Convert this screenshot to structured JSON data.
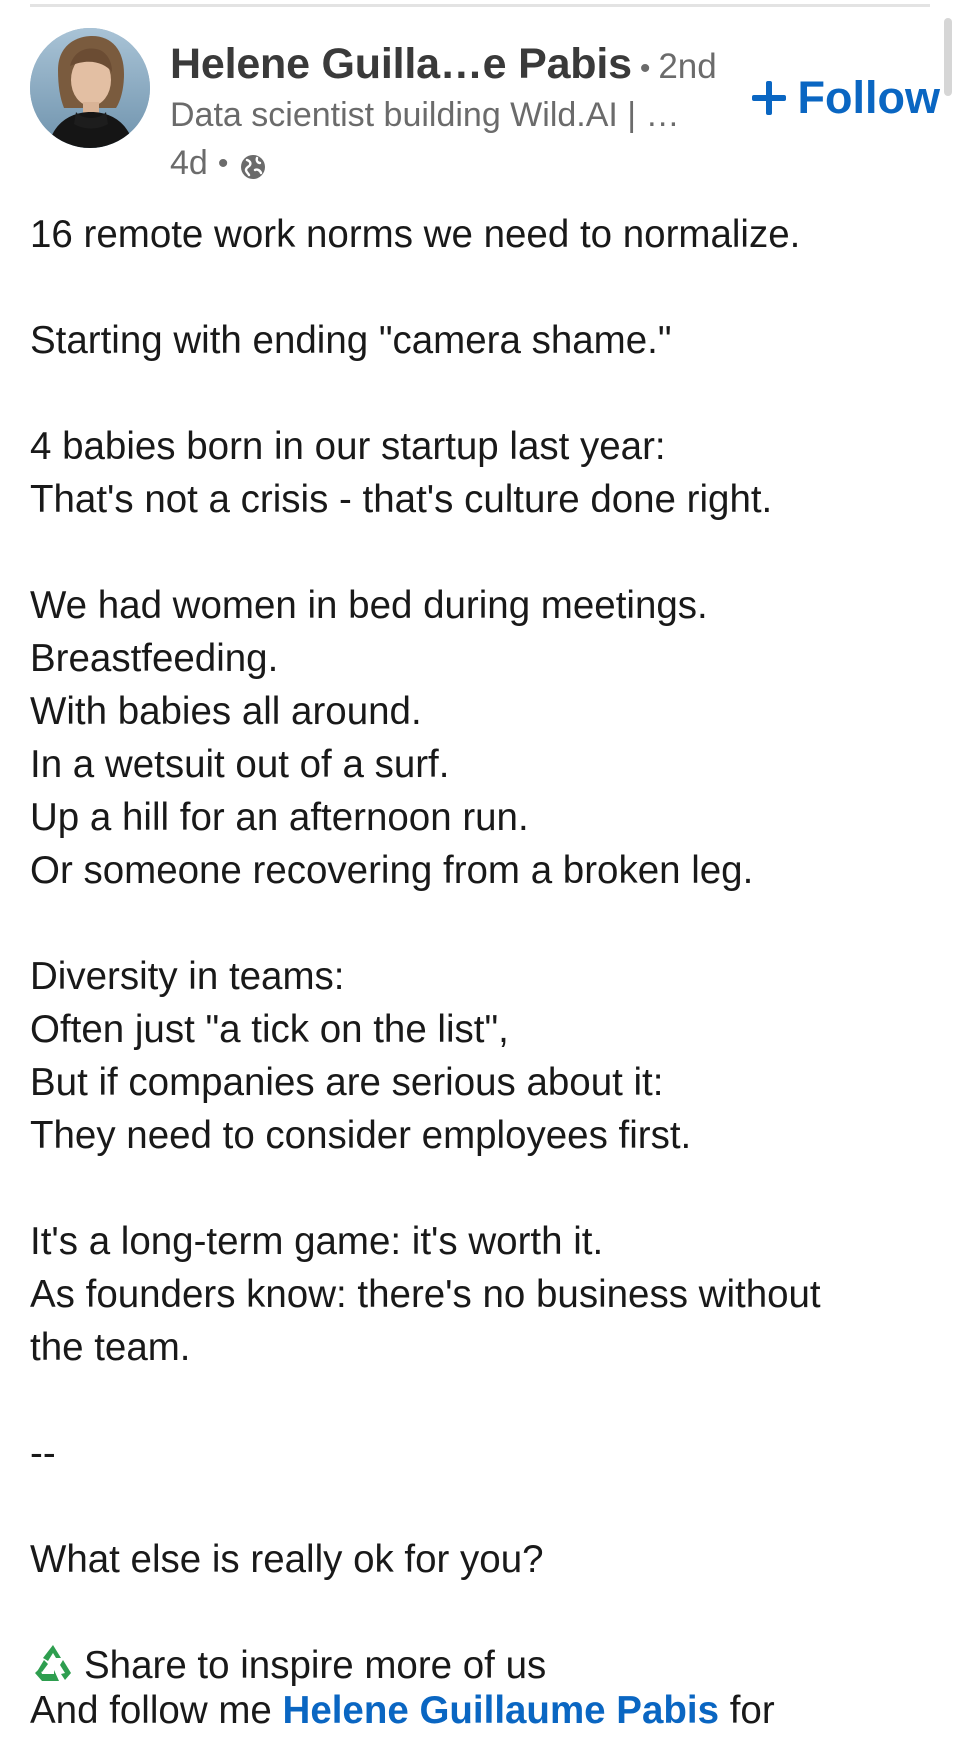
{
  "author": {
    "name": "Helene Guilla…e Pabis",
    "degree": "2nd",
    "headline": "Data scientist building Wild.AI | …",
    "time": "4d",
    "separator": "•"
  },
  "follow_button": {
    "label": "Follow"
  },
  "post": {
    "lines": [
      "16 remote work norms we need to normalize.",
      "",
      "Starting with ending \"camera shame.\"",
      "",
      "4 babies born in our startup last year:",
      "That's not a crisis - that's culture done right.",
      "",
      "We had women in bed during meetings.",
      "Breastfeeding.",
      "With babies all around.",
      "In a wetsuit out of a surf.",
      "Up a hill for an afternoon run.",
      "Or someone recovering from a broken leg.",
      "",
      "Diversity in teams:",
      "Often just \"a tick on the list\",",
      "But if companies are serious about it:",
      "They need to consider employees first.",
      "",
      "It's a long-term game: it's worth it.",
      "As founders know: there's no business without",
      "the team.",
      "",
      "--",
      "",
      "What else is really ok for you?",
      ""
    ],
    "share_line": "Share to inspire more of us",
    "cut_line_prefix": "And follow me",
    "cut_line_mention": "Helene Guillaume Pabis",
    "cut_line_suffix": " for"
  },
  "colors": {
    "link_blue": "#0a66c2",
    "text": "#191919",
    "muted": "#6b6b6b",
    "recycle_green": "#2e9e4f"
  },
  "icons": {
    "globe": "globe-icon",
    "plus": "plus-icon",
    "recycle": "recycle-icon"
  }
}
